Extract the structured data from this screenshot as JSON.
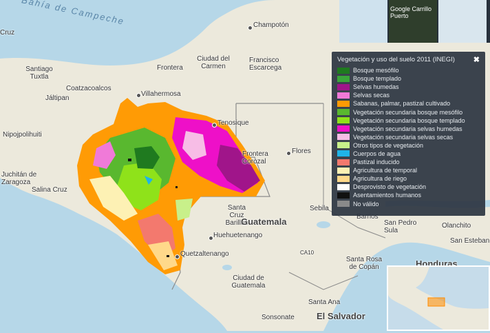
{
  "colors": {
    "sea": "#b6d7e8",
    "land": "#ece9dc",
    "legend_bg": "#2d3642"
  },
  "layer_tiles": {
    "selected_label": "Google Carrillo Puerto"
  },
  "legend": {
    "title": "Vegetación y uso del suelo 2011 (INEGI)",
    "close_icon": "close-icon",
    "items": [
      {
        "label": "Bosque mesófilo",
        "color": "#1f7a1f"
      },
      {
        "label": "Bosque templado",
        "color": "#3aa63a"
      },
      {
        "label": "Selvas humedas",
        "color": "#a0158a"
      },
      {
        "label": "Selvas secas",
        "color": "#f07ad8"
      },
      {
        "label": "Sabanas, palmar, pastizal cultivado",
        "color": "#ff9b05"
      },
      {
        "label": "Vegetación secundaria bosque mesófilo",
        "color": "#59b82f"
      },
      {
        "label": "Vegetación secundaria bosque templado",
        "color": "#8fe21a"
      },
      {
        "label": "Vegetación secundaria selvas humedas",
        "color": "#ee10c8"
      },
      {
        "label": "Vegetación secundaria selvas secas",
        "color": "#f7bde6"
      },
      {
        "label": "Otros tipos de vegetación",
        "color": "#c8f08a"
      },
      {
        "label": "Cuerpos de agua",
        "color": "#1fb4e8"
      },
      {
        "label": "Pastizal inducido",
        "color": "#f3796e"
      },
      {
        "label": "Agricultura de temporal",
        "color": "#fdf1b4"
      },
      {
        "label": "Agricultura de riego",
        "color": "#ffd98a"
      },
      {
        "label": "Desprovisto de vegetación",
        "color": "#ffffff"
      },
      {
        "label": "Asentamientos humanos",
        "color": "#111111"
      },
      {
        "label": "No válido",
        "color": "#8a8a8a"
      }
    ]
  },
  "places": {
    "campeche_bay": "Bahía de Campeche",
    "champoton": "Champotón",
    "cruz": "Cruz",
    "ciudad_del_carmen": "Ciudad del Carmen",
    "francisco_escarcega": "Francisco Escarcega",
    "frontera": "Frontera",
    "santiago_tuxtla": "Santiago Tuxtla",
    "coatzacoalcos": "Coatzacoalcos",
    "villahermosa": "Villahermosa",
    "jaltipan": "Jáltipan",
    "tenosique": "Tenosique",
    "nipojpolihuiti": "Nipojpolihuiti",
    "frontera_corozal": "Frontera Corozal",
    "flores": "Flores",
    "juchitan": "Juchitán de Zaragoza",
    "salina_cruz": "Salina Cruz",
    "santa_cruz_barillas": "Santa Cruz Barillas",
    "guatemala": "Guatemala",
    "sebila": "Sebila",
    "barrios": "Barrios",
    "san_pedro_sula": "San Pedro Sula",
    "olanchito": "Olanchito",
    "san_esteban": "San Esteban",
    "huehuetenango": "Huehuetenango",
    "quetzaltenango": "Quetzaltenango",
    "ciudad_de_guatemala": "Ciudad de Guatemala",
    "ca10": "CA10",
    "santa_rosa_de_copan": "Santa Rosa de Copán",
    "honduras": "Honduras",
    "santa_ana": "Santa Ana",
    "sonsonate": "Sonsonate",
    "el_salvador": "El Salvador"
  }
}
